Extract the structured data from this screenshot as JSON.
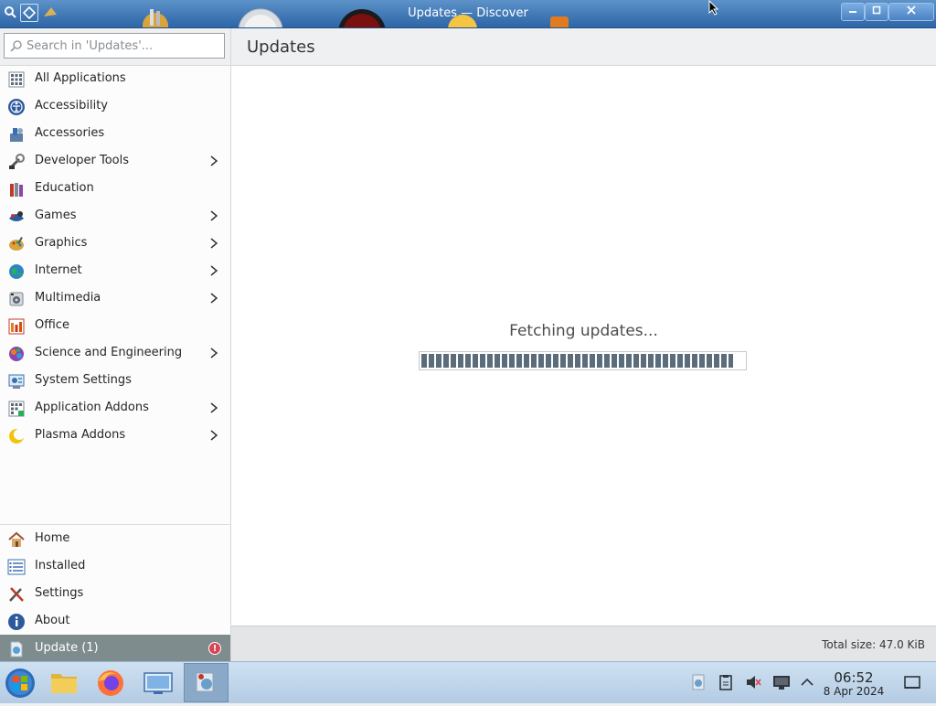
{
  "window": {
    "title": "Updates — Discover",
    "minimize_icon": "minimize-icon",
    "maximize_icon": "maximize-icon",
    "close_icon": "close-icon"
  },
  "search": {
    "placeholder": "Search in 'Updates'...",
    "value": "",
    "icon": "search-icon"
  },
  "categories": [
    {
      "label": "All Applications",
      "icon": "all-applications-icon",
      "submenu": false
    },
    {
      "label": "Accessibility",
      "icon": "accessibility-icon",
      "submenu": false
    },
    {
      "label": "Accessories",
      "icon": "accessories-icon",
      "submenu": false
    },
    {
      "label": "Developer Tools",
      "icon": "developer-tools-icon",
      "submenu": true
    },
    {
      "label": "Education",
      "icon": "education-icon",
      "submenu": false
    },
    {
      "label": "Games",
      "icon": "games-icon",
      "submenu": true
    },
    {
      "label": "Graphics",
      "icon": "graphics-icon",
      "submenu": true
    },
    {
      "label": "Internet",
      "icon": "internet-icon",
      "submenu": true
    },
    {
      "label": "Multimedia",
      "icon": "multimedia-icon",
      "submenu": true
    },
    {
      "label": "Office",
      "icon": "office-icon",
      "submenu": false
    },
    {
      "label": "Science and Engineering",
      "icon": "science-icon",
      "submenu": true
    },
    {
      "label": "System Settings",
      "icon": "system-settings-icon",
      "submenu": false
    },
    {
      "label": "Application Addons",
      "icon": "application-addons-icon",
      "submenu": true
    },
    {
      "label": "Plasma Addons",
      "icon": "plasma-addons-icon",
      "submenu": true
    }
  ],
  "nav": {
    "home": "Home",
    "installed": "Installed",
    "settings": "Settings",
    "about": "About",
    "update": "Update (1)",
    "update_badge": "!"
  },
  "main": {
    "title": "Updates",
    "status": "Fetching updates...",
    "progress_fraction": 0.96,
    "total_size": "Total size: 47.0 KiB"
  },
  "taskbar": {
    "apps": [
      "start-menu-icon",
      "file-manager-icon",
      "firefox-icon",
      "system-monitor-icon",
      "discover-icon"
    ],
    "tray": [
      "discover-notifier-icon",
      "clipboard-icon",
      "volume-muted-icon",
      "display-icon",
      "chevron-up-icon",
      "show-desktop-icon"
    ],
    "time": "06:52",
    "date": "8 Apr 2024"
  },
  "colors": {
    "titlebar": "#3f76b4",
    "selected_row": "#7f8c8d",
    "progress_fill": "#5b6c7b",
    "badge": "#da4453"
  }
}
